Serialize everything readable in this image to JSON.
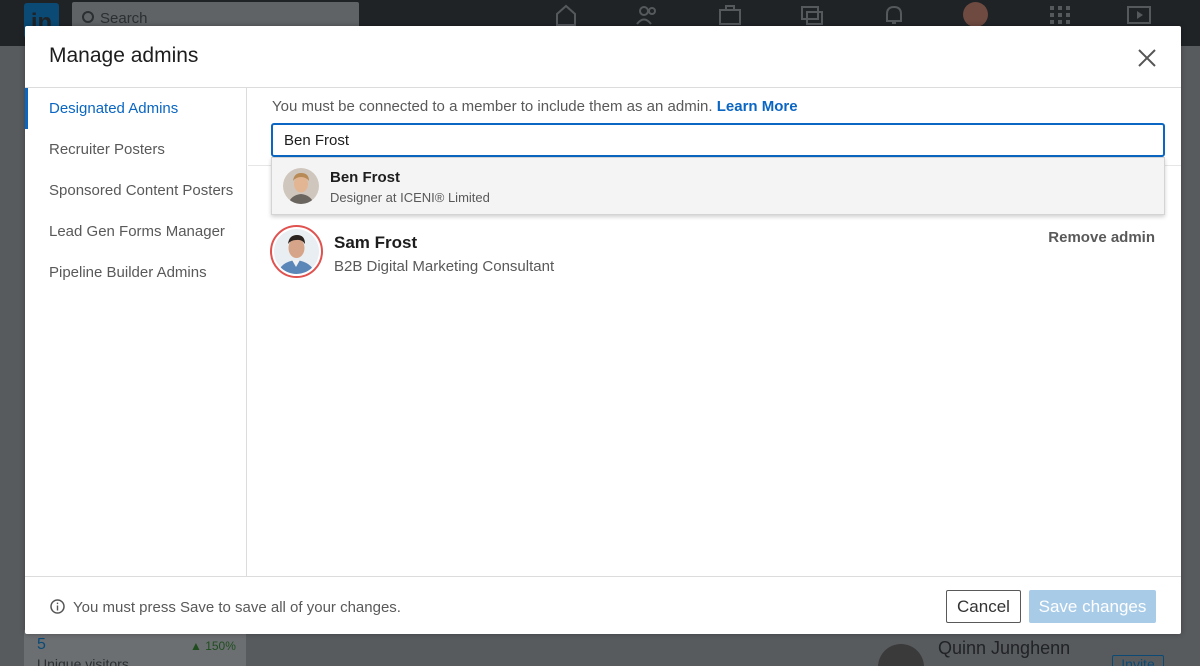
{
  "background": {
    "logo_text": "in",
    "search_placeholder": "Search",
    "stat_value": "5",
    "stat_change": "▲ 150%",
    "stat_label": "Unique visitors",
    "right_person_name": "Quinn Junghenn",
    "invite_label": "Invite"
  },
  "modal": {
    "title": "Manage admins",
    "close_icon": "close-icon"
  },
  "sidebar": {
    "items": [
      {
        "label": "Designated Admins",
        "active": true
      },
      {
        "label": "Recruiter Posters",
        "active": false
      },
      {
        "label": "Sponsored Content Posters",
        "active": false
      },
      {
        "label": "Lead Gen Forms Manager",
        "active": false
      },
      {
        "label": "Pipeline Builder Admins",
        "active": false
      }
    ]
  },
  "content": {
    "info_text": "You must be connected to a member to include them as an admin.",
    "learn_more": "Learn More",
    "search_value": "Ben Frost",
    "suggestion": {
      "name": "Ben Frost",
      "title": "Designer at ICENI® Limited"
    },
    "admins": [
      {
        "name": "Sam Frost",
        "title": "B2B Digital Marketing Consultant",
        "remove_label": "Remove admin"
      }
    ]
  },
  "footer": {
    "info_text": "You must press Save to save all of your changes.",
    "cancel_label": "Cancel",
    "save_label": "Save changes"
  },
  "colors": {
    "accent": "#0a66c2",
    "save_disabled": "#a8cbe8",
    "avatar_ring": "#e0524f"
  }
}
